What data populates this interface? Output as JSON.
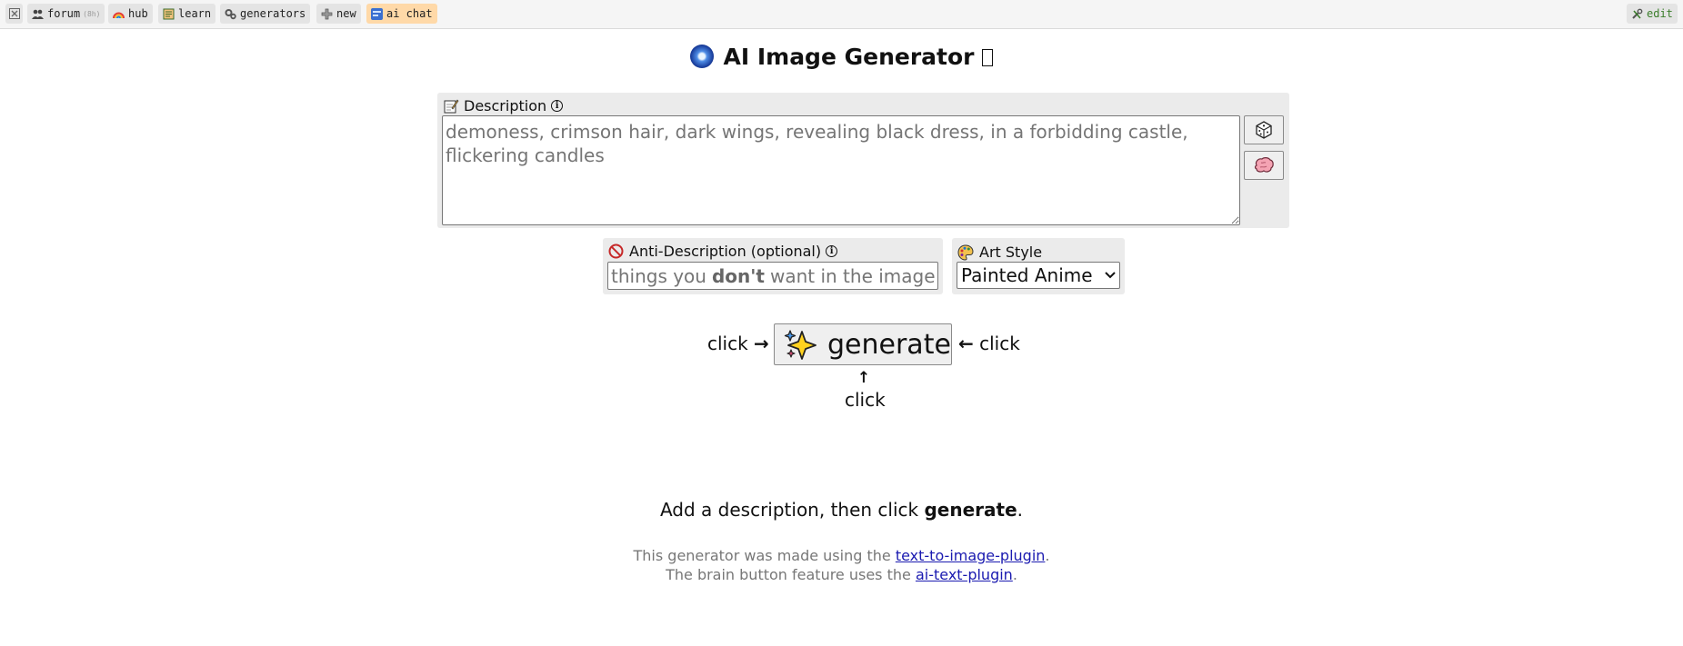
{
  "nav": {
    "home_icon": "close-box-icon",
    "items": [
      {
        "label": "forum",
        "count": "(8h)",
        "icon": "people-icon"
      },
      {
        "label": "hub",
        "icon": "rainbow-icon"
      },
      {
        "label": "learn",
        "icon": "book-icon"
      },
      {
        "label": "generators",
        "icon": "gears-icon"
      },
      {
        "label": "new",
        "icon": "plus-icon"
      },
      {
        "label": "ai chat",
        "icon": "chat-icon"
      }
    ],
    "edit_label": "edit"
  },
  "title": "AI Image Generator",
  "description": {
    "label": "Description",
    "info": "i",
    "value": "demoness, crimson hair, dark wings, revealing black dress, in a forbidding castle, flickering candles"
  },
  "anti_description": {
    "label": "Anti-Description (optional)",
    "info": "i",
    "placeholder_pre": "things you",
    "placeholder_bold": "don't",
    "placeholder_post": "want in the image"
  },
  "art_style": {
    "label": "Art Style",
    "selected": "Painted Anime"
  },
  "generate": {
    "label": "generate",
    "click_left": "click",
    "click_right": "click",
    "click_below": "click",
    "arrow_left": "→",
    "arrow_right": "←",
    "arrow_up": "↑"
  },
  "message": {
    "pre": "Add a description, then click",
    "bold": "generate",
    "post": "."
  },
  "credits": {
    "line1_pre": "This generator was made using the",
    "line1_link": "text-to-image-plugin",
    "line1_post": ".",
    "line2_pre": "The brain button feature uses the",
    "line2_link": "ai-text-plugin",
    "line2_post": "."
  },
  "colors": {
    "active_nav": "#ffd9a8",
    "panel_bg": "#ebebeb",
    "link": "#1a1ab0",
    "edit": "#3a7d2a"
  }
}
